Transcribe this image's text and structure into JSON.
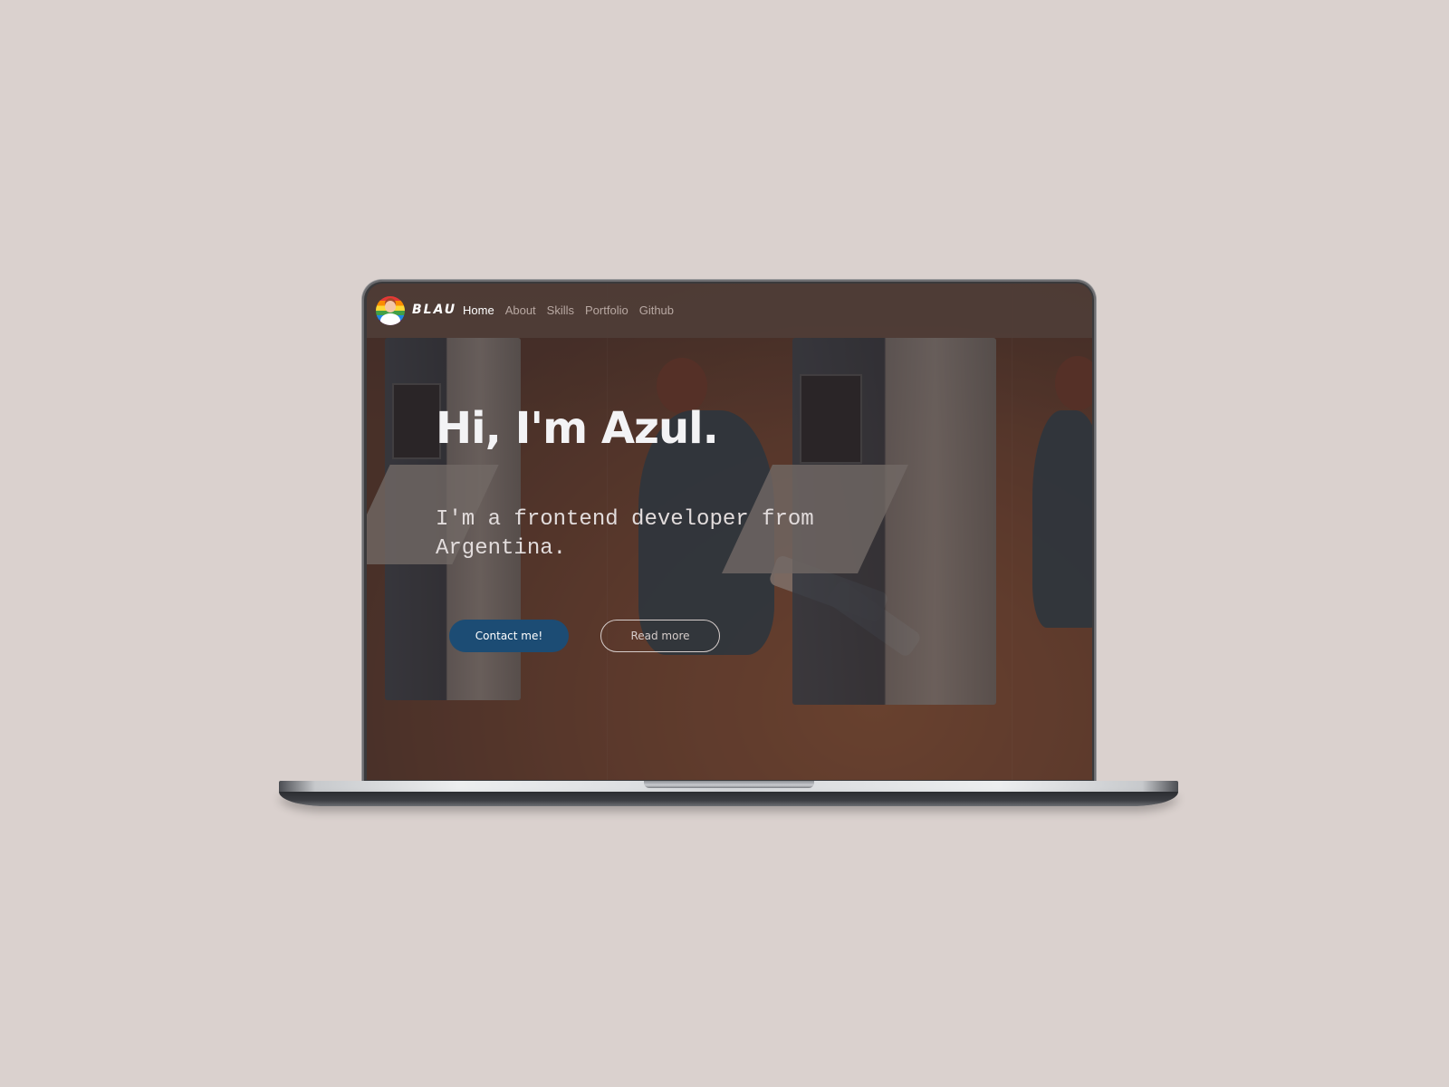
{
  "brand": {
    "name": "BLAU"
  },
  "nav": {
    "items": [
      {
        "label": "Home",
        "active": true
      },
      {
        "label": "About",
        "active": false
      },
      {
        "label": "Skills",
        "active": false
      },
      {
        "label": "Portfolio",
        "active": false
      },
      {
        "label": "Github",
        "active": false
      }
    ]
  },
  "hero": {
    "title": "Hi, I'm Azul.",
    "subtitle": "I'm a frontend developer from Argentina.",
    "primary_button": "Contact me!",
    "secondary_button": "Read more"
  },
  "colors": {
    "page_background": "#dad1ce",
    "primary_button": "#1c4c74",
    "hero_text": "#f3f3f5"
  }
}
